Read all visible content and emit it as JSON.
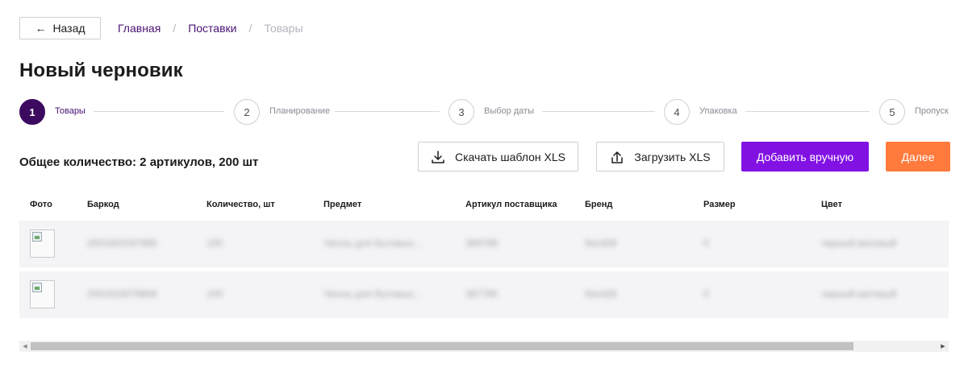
{
  "header": {
    "back_label": "Назад",
    "breadcrumbs": [
      "Главная",
      "Поставки",
      "Товары"
    ],
    "breadcrumb_separator": "/"
  },
  "page_title": "Новый черновик",
  "stepper": {
    "steps": [
      {
        "number": "1",
        "label": "Товары",
        "active": true
      },
      {
        "number": "2",
        "label": "Планирование",
        "active": false
      },
      {
        "number": "3",
        "label": "Выбор даты",
        "active": false
      },
      {
        "number": "4",
        "label": "Упаковка",
        "active": false
      },
      {
        "number": "5",
        "label": "Пропуск",
        "active": false
      }
    ]
  },
  "summary": "Общее количество: 2 артикулов, 200 шт",
  "actions": {
    "download_template": "Скачать шаблон XLS",
    "upload_xls": "Загрузить XLS",
    "add_manually": "Добавить вручную",
    "next": "Далее"
  },
  "table": {
    "columns": [
      "Фото",
      "Баркод",
      "Количество, шт",
      "Предмет",
      "Артикул поставщика",
      "Бренд",
      "Размер",
      "Цвет"
    ],
    "rows": [
      {
        "barcode": "2001920187685",
        "quantity": "100",
        "subject": "Чехлы для бытовых...",
        "article": "369789",
        "brand": "Nord28",
        "size": "0",
        "color": "черный матовый"
      },
      {
        "barcode": "2001916078906",
        "quantity": "100",
        "subject": "Чехлы для бытовых...",
        "article": "367785",
        "brand": "Nord28",
        "size": "0",
        "color": "черный матовый"
      }
    ]
  },
  "colors": {
    "brand_purple": "#8212e4",
    "accent_orange": "#ff7a3c",
    "active_step": "#3c0a5e",
    "link_purple": "#481173"
  }
}
